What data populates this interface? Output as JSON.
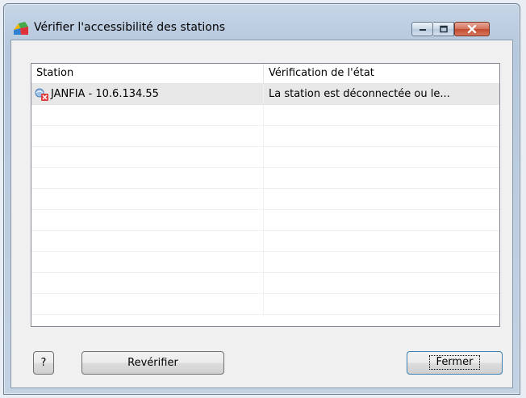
{
  "window": {
    "title": "Vérifier l'accessibilité des stations",
    "controls": {
      "minimize": "minimize-icon",
      "maximize": "maximize-icon",
      "close": "close-icon"
    },
    "colors": {
      "titlebar": "#bccde1",
      "close_button": "#c14a2e",
      "selection": "#e8e8e8"
    }
  },
  "table": {
    "columns": [
      "Station",
      "Vérification de l'état"
    ],
    "rows": [
      {
        "station": "JANFIA - 10.6.134.55",
        "status": "La station est déconnectée ou le...",
        "icon": "station-disconnected-icon",
        "selected": true
      }
    ]
  },
  "buttons": {
    "help": "?",
    "recheck": "Revérifier",
    "close": "Fermer"
  }
}
